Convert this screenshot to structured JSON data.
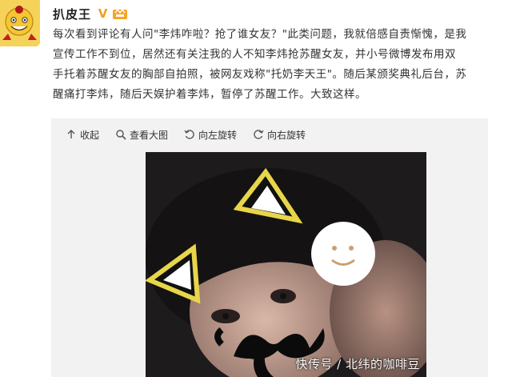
{
  "post": {
    "username": "扒皮王",
    "verified_badge": "V",
    "text_lines": [
      "每次看到评论有人问\"李炜咋啦？抢了谁女友？\"此类问题，我就倍感自责惭愧，是我",
      "宣传工作不到位，居然还有关注我的人不知李炜抢苏醒女友，并小号微博发布用双",
      "手托着苏醒女友的胸部自拍照，被网友戏称\"托奶李天王\"。随后某颁奖典礼后台，苏",
      "醒痛打李炜，随后天娱护着李炜，暂停了苏醒工作。大致这样。"
    ]
  },
  "toolbar": {
    "collapse": "收起",
    "view_large": "查看大图",
    "rotate_left": "向左旋转",
    "rotate_right": "向右旋转"
  },
  "watermark": "快传号 / 北纬的咖啡豆",
  "icons": {
    "collapse": "arrow-up-icon",
    "view_large": "magnifier-icon",
    "rotate_left": "rotate-left-icon",
    "rotate_right": "rotate-right-icon"
  },
  "colors": {
    "avatar_bg": "#f3c94a",
    "panel_bg": "#f2f2f2",
    "vip": "#f0a020"
  }
}
